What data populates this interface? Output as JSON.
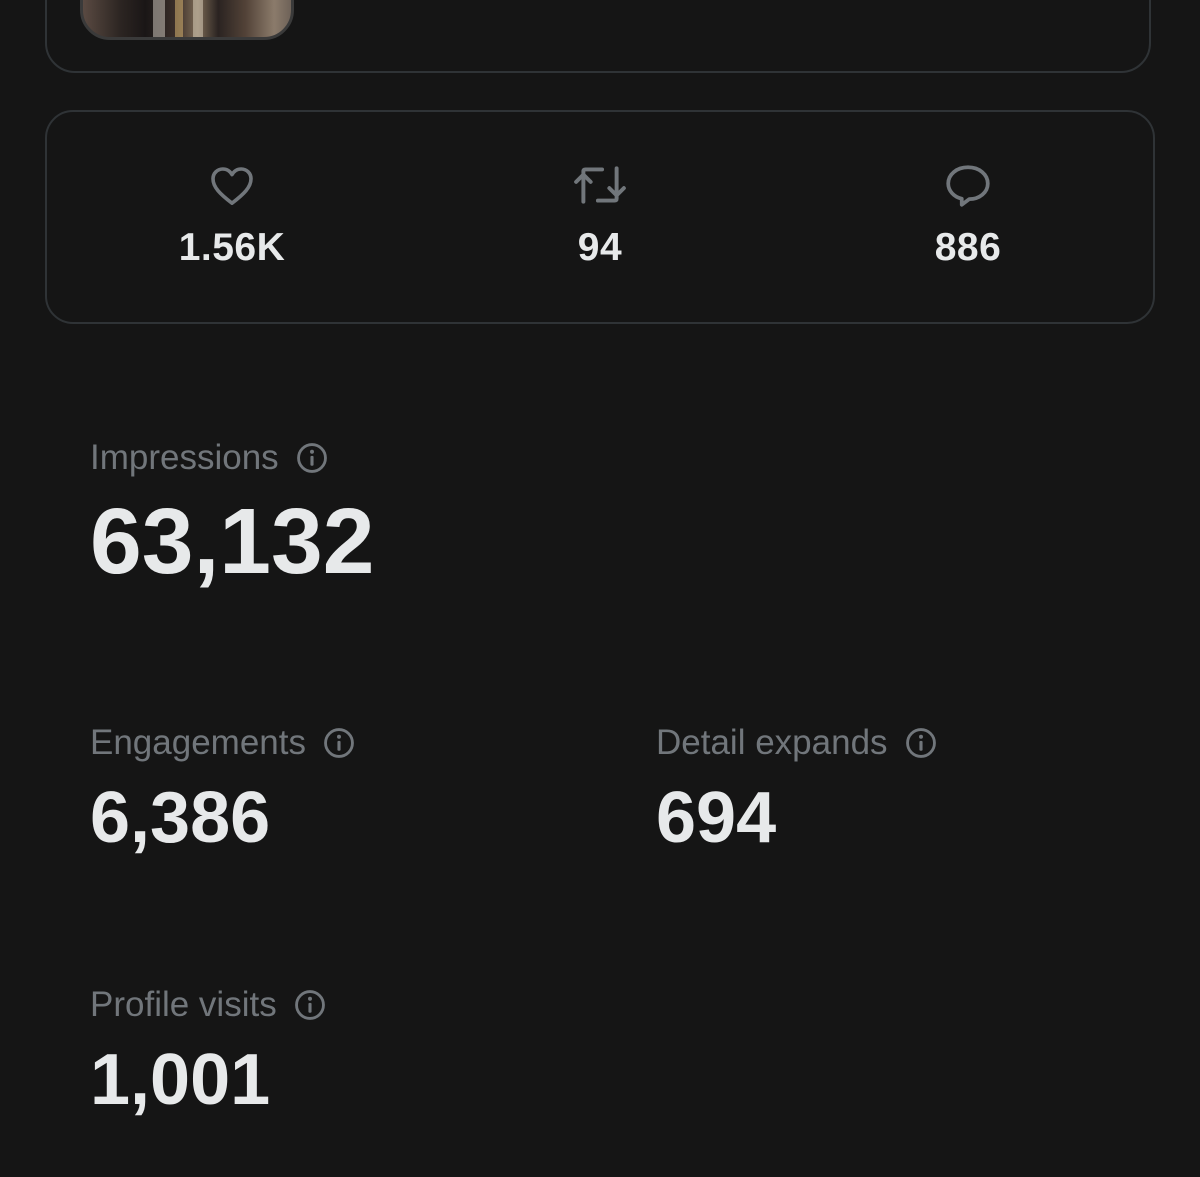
{
  "post_metrics": {
    "likes": "1.56K",
    "reposts": "94",
    "replies": "886"
  },
  "icons": {
    "like": "heart-icon",
    "repost": "repost-icon",
    "reply": "reply-bubble-icon",
    "info": "info-icon"
  },
  "analytics": {
    "impressions": {
      "label": "Impressions",
      "value": "63,132"
    },
    "engagements": {
      "label": "Engagements",
      "value": "6,386"
    },
    "detail_expands": {
      "label": "Detail expands",
      "value": "694"
    },
    "profile_visits": {
      "label": "Profile visits",
      "value": "1,001"
    }
  },
  "colors": {
    "background": "#151515",
    "border": "#2f3336",
    "label": "#71767b",
    "value": "#e7e9ea"
  }
}
